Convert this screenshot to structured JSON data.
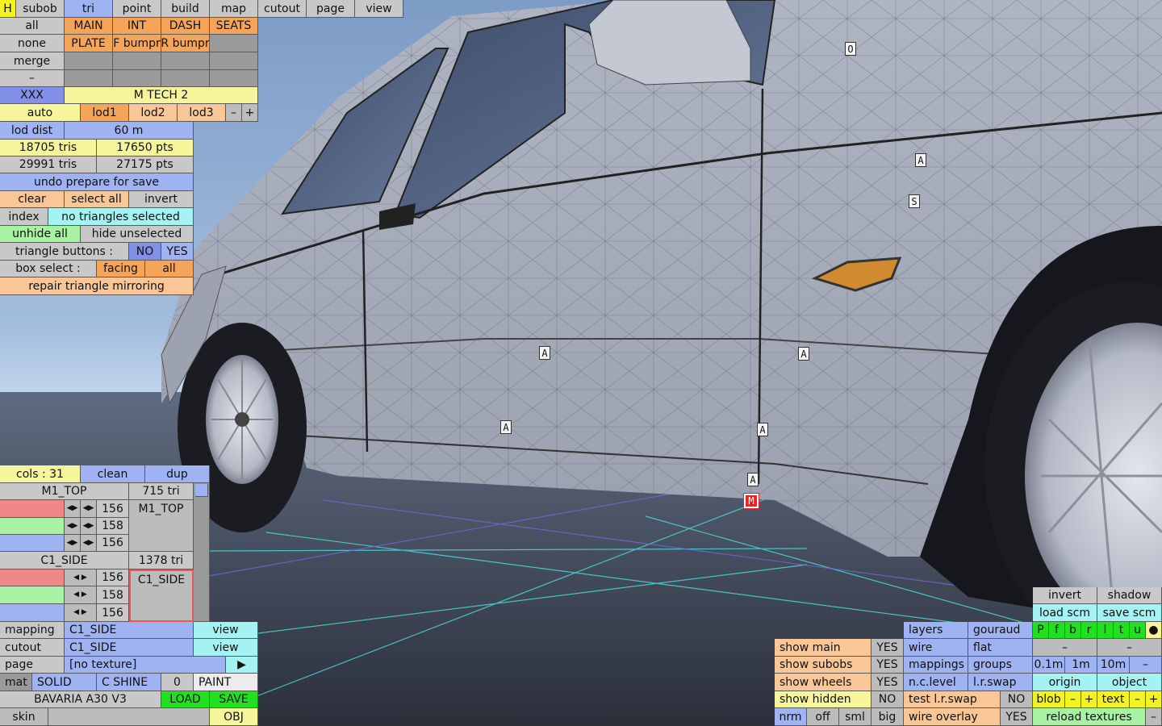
{
  "toolbar": {
    "h": "H",
    "tabs": [
      "subob",
      "tri",
      "point",
      "build",
      "map",
      "cutout",
      "page",
      "view"
    ]
  },
  "select": {
    "all": "all",
    "none": "none",
    "merge": "merge",
    "dash": "–",
    "xxx": "XXX",
    "auto": "auto"
  },
  "subobs": {
    "row1": [
      "MAIN",
      "INT",
      "DASH",
      "SEATS"
    ],
    "row2": [
      "PLATE",
      "F bumpr",
      "R bumpr"
    ]
  },
  "model_name": "M TECH 2",
  "lods": [
    "lod1",
    "lod2",
    "lod3"
  ],
  "lod_minus": "–",
  "lod_plus": "+",
  "lod_dist": {
    "label": "lod dist",
    "value": "60 m"
  },
  "stats": {
    "tris1": "18705 tris",
    "pts1": "17650 pts",
    "tris2": "29991 tris",
    "pts2": "27175 pts"
  },
  "tri_panel": {
    "undo": "undo prepare for save",
    "clear": "clear",
    "select_all": "select all",
    "invert": "invert",
    "index": "index",
    "status": "no triangles selected",
    "unhide": "unhide all",
    "hide_unsel": "hide unselected",
    "tri_buttons": "triangle buttons :",
    "no": "NO",
    "yes": "YES",
    "box_select": "box select :",
    "facing": "facing",
    "all": "all",
    "repair": "repair triangle mirroring"
  },
  "cols": {
    "label": "cols : 31",
    "clean": "clean",
    "dup": "dup"
  },
  "materials": [
    {
      "name": "M1_TOP",
      "tris": "715 tri",
      "values": [
        "156",
        "158",
        "156"
      ],
      "preview": "M1_TOP"
    },
    {
      "name": "C1_SIDE",
      "tris": "1378 tri",
      "values": [
        "156",
        "158",
        "156"
      ],
      "preview": "C1_SIDE"
    }
  ],
  "mapping": {
    "mapping": "mapping",
    "mapping_val": "C1_SIDE",
    "view": "view",
    "cutout": "cutout",
    "cutout_val": "C1_SIDE",
    "view2": "view",
    "page": "page",
    "page_val": "[no texture]",
    "play": "▶",
    "mat": "mat",
    "solid": "SOLID",
    "shine": "C SHINE",
    "zero": "0",
    "paint": "PAINT",
    "car": "BAVARIA A30 V3",
    "load": "LOAD",
    "save": "SAVE",
    "skin": "skin",
    "obj": "OBJ"
  },
  "show": {
    "main": "show main",
    "main_v": "YES",
    "subobs": "show subobs",
    "subobs_v": "YES",
    "wheels": "show wheels",
    "wheels_v": "YES",
    "hidden": "show hidden",
    "hidden_v": "NO",
    "nrm": "nrm",
    "off": "off",
    "sml": "sml",
    "big": "big"
  },
  "render": {
    "layers": "layers",
    "gouraud": "gouraud",
    "wire": "wire",
    "flat": "flat",
    "mappings": "mappings",
    "groups": "groups",
    "nclevel": "n.c.level",
    "lrswap": "l.r.swap",
    "test": "test l.r.swap",
    "test_v": "NO",
    "overlay": "wire overlay",
    "overlay_v": "YES"
  },
  "right": {
    "invert": "invert",
    "shadow": "shadow",
    "load_scm": "load scm",
    "save_scm": "save scm",
    "letters": [
      "P",
      "f",
      "b",
      "r",
      "l",
      "t",
      "u",
      "●"
    ],
    "m1": "–",
    "m2": "–",
    "d1": "0.1m",
    "d2": "1m",
    "d3": "10m",
    "dm": "–",
    "origin": "origin",
    "object": "object",
    "blob": "blob",
    "bm": "–",
    "bp": "+",
    "text": "text",
    "tm": "–",
    "tp": "+",
    "reload": "reload textures",
    "rm": "–"
  },
  "markers": [
    "O",
    "A",
    "S",
    "A",
    "A",
    "A",
    "A",
    "A",
    "M"
  ],
  "colors": {
    "accent_blue": "#9fb2f2",
    "orange": "#f5a55a",
    "yellow": "#f6f59c",
    "green": "#a8f2a4",
    "cyan": "#a4f2f2",
    "load_green": "#20e020"
  }
}
